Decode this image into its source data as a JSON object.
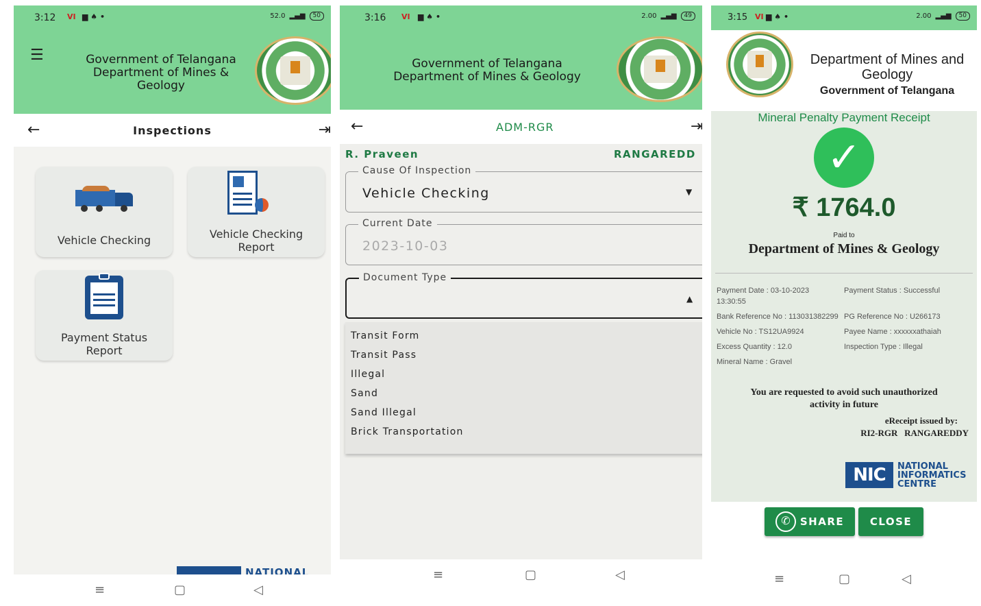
{
  "screen1": {
    "status_time": "3:12",
    "status_speed": "52.0",
    "battery": "50",
    "header_line1": "Government of Telangana",
    "header_line2": "Department of Mines &",
    "header_line3": "Geology",
    "nav_title": "Inspections",
    "cards": [
      {
        "label": "Vehicle Checking"
      },
      {
        "label1": "Vehicle Checking",
        "label2": "Report"
      },
      {
        "label1": "Payment Status",
        "label2": "Report"
      }
    ],
    "footer_partial": "NATIONAL"
  },
  "screen2": {
    "status_time": "3:16",
    "status_speed": "2.00",
    "battery": "49",
    "header_line1": "Government of Telangana",
    "header_line2": "Department of Mines & Geology",
    "nav_title": "ADM-RGR",
    "user_name": "R. Praveen",
    "district": "RANGAREDD",
    "cause_label": "Cause Of Inspection",
    "cause_value": "Vehicle Checking",
    "date_label": "Current Date",
    "date_value": "2023-10-03",
    "doc_label": "Document Type",
    "options": [
      "Transit Form",
      "Transit Pass",
      "Illegal",
      "Sand",
      "Sand Illegal",
      "Brick Transportation"
    ]
  },
  "screen3": {
    "status_time": "3:15",
    "status_speed": "2.00",
    "battery": "50",
    "dept_line1": "Department of Mines and",
    "dept_line2": "Geology",
    "govt": "Government of Telangana",
    "receipt_title": "Mineral Penalty Payment Receipt",
    "amount": "₹ 1764.0",
    "paid_to": "Paid to",
    "payee_dept": "Department of Mines & Geology",
    "payment_date": "Payment Date : 03-10-2023",
    "payment_time": "13:30:55",
    "payment_status": "Payment Status : Successful",
    "bank_ref": "Bank Reference No : 113031382299",
    "pg_ref": "PG Reference No : U266173",
    "vehicle_no": "Vehicle No : TS12UA9924",
    "payee_name": "Payee Name : xxxxxxathaiah",
    "excess_qty": "Excess Quantity : 12.0",
    "inspection_type": "Inspection Type : Illegal",
    "mineral": "Mineral Name : Gravel",
    "warning1": "You are requested to avoid such unauthorized",
    "warning2": "activity in future",
    "issued_by": "eReceipt issued by:",
    "issuer": "RI2-RGR   RANGAREDDY",
    "nic1": "NATIONAL",
    "nic2": "INFORMATICS",
    "nic3": "CENTRE",
    "nic_logo": "NIC",
    "share": "SHARE",
    "close": "CLOSE"
  }
}
